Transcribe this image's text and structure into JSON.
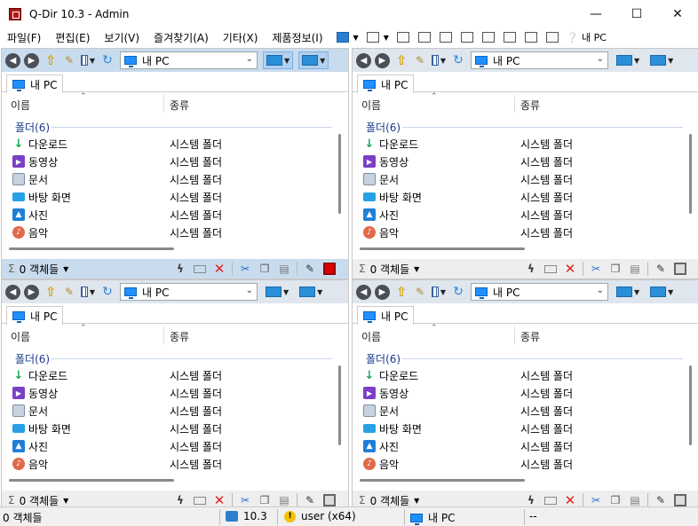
{
  "window": {
    "title": "Q-Dir 10.3 - Admin",
    "minimize": "—",
    "maximize": "☐",
    "close": "✕"
  },
  "menu": {
    "items": [
      "파일(F)",
      "편집(E)",
      "보기(V)",
      "즐겨찾기(A)",
      "기타(X)",
      "제품정보(I)"
    ],
    "overflow_label": "내 PC"
  },
  "panes": [
    {
      "address": "내 PC",
      "tab": "내 PC",
      "columns": {
        "name": "이름",
        "type": "종류"
      },
      "group": "폴더(6)",
      "rows": [
        {
          "name": "다운로드",
          "type": "시스템 폴더",
          "icon": "download-icon"
        },
        {
          "name": "동영상",
          "type": "시스템 폴더",
          "icon": "video-icon"
        },
        {
          "name": "문서",
          "type": "시스템 폴더",
          "icon": "document-icon"
        },
        {
          "name": "바탕 화면",
          "type": "시스템 폴더",
          "icon": "desktop-icon"
        },
        {
          "name": "사진",
          "type": "시스템 폴더",
          "icon": "pictures-icon"
        },
        {
          "name": "음악",
          "type": "시스템 폴더",
          "icon": "music-icon"
        }
      ],
      "status": "0 객체들"
    },
    {
      "address": "내 PC",
      "tab": "내 PC",
      "columns": {
        "name": "이름",
        "type": "종류"
      },
      "group": "폴더(6)",
      "rows": [
        {
          "name": "다운로드",
          "type": "시스템 폴더",
          "icon": "download-icon"
        },
        {
          "name": "동영상",
          "type": "시스템 폴더",
          "icon": "video-icon"
        },
        {
          "name": "문서",
          "type": "시스템 폴더",
          "icon": "document-icon"
        },
        {
          "name": "바탕 화면",
          "type": "시스템 폴더",
          "icon": "desktop-icon"
        },
        {
          "name": "사진",
          "type": "시스템 폴더",
          "icon": "pictures-icon"
        },
        {
          "name": "음악",
          "type": "시스템 폴더",
          "icon": "music-icon"
        }
      ],
      "status": "0 객체들"
    },
    {
      "address": "내 PC",
      "tab": "내 PC",
      "columns": {
        "name": "이름",
        "type": "종류"
      },
      "group": "폴더(6)",
      "rows": [
        {
          "name": "다운로드",
          "type": "시스템 폴더",
          "icon": "download-icon"
        },
        {
          "name": "동영상",
          "type": "시스템 폴더",
          "icon": "video-icon"
        },
        {
          "name": "문서",
          "type": "시스템 폴더",
          "icon": "document-icon"
        },
        {
          "name": "바탕 화면",
          "type": "시스템 폴더",
          "icon": "desktop-icon"
        },
        {
          "name": "사진",
          "type": "시스템 폴더",
          "icon": "pictures-icon"
        },
        {
          "name": "음악",
          "type": "시스템 폴더",
          "icon": "music-icon"
        }
      ],
      "status": "0 객체들"
    },
    {
      "address": "내 PC",
      "tab": "내 PC",
      "columns": {
        "name": "이름",
        "type": "종류"
      },
      "group": "폴더(6)",
      "rows": [
        {
          "name": "다운로드",
          "type": "시스템 폴더",
          "icon": "download-icon"
        },
        {
          "name": "동영상",
          "type": "시스템 폴더",
          "icon": "video-icon"
        },
        {
          "name": "문서",
          "type": "시스템 폴더",
          "icon": "document-icon"
        },
        {
          "name": "바탕 화면",
          "type": "시스템 폴더",
          "icon": "desktop-icon"
        },
        {
          "name": "사진",
          "type": "시스템 폴더",
          "icon": "pictures-icon"
        },
        {
          "name": "음악",
          "type": "시스템 폴더",
          "icon": "music-icon"
        }
      ],
      "status": "0 객체들"
    }
  ],
  "bottom": {
    "objects": "0 객체들",
    "version": "10.3",
    "user": "user (x64)",
    "location": "내 PC",
    "extra": "--"
  },
  "colors": {
    "active_toolbar": "#c9dcee",
    "inactive_toolbar": "#dfe6ee",
    "group_text": "#1a3d8c"
  }
}
